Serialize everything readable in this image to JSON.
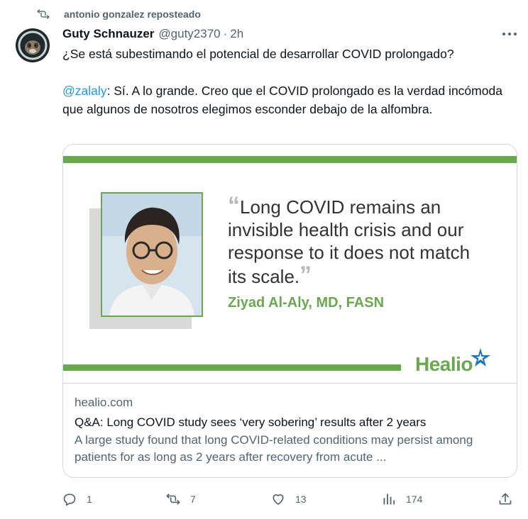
{
  "repost": {
    "text": "antonio gonzalez reposteado",
    "icon": "repost-icon"
  },
  "author": {
    "name": "Guty Schnauzer",
    "handle": "@guty2370",
    "separator": "·",
    "time": "2h",
    "avatar_icon": "avatar-icon"
  },
  "menu": {
    "icon": "more-icon",
    "label": "···"
  },
  "tweet": {
    "line1": "¿Se está subestimando el potencial de desarrollar COVID prolongado?",
    "mention": "@zalaly",
    "reply_text": ": Sí. A lo grande. Creo que el COVID prolongado es la verdad incómoda que algunos de nosotros elegimos esconder debajo de la alfombra."
  },
  "card": {
    "quote_open": "“",
    "quote": "Long COVID remains an invisible health crisis and our response to it does not match its scale.",
    "quote_close": "”",
    "attribution": "Ziyad Al-Aly, MD, FASN",
    "brand": "Healio",
    "accent_color": "#6aa84f",
    "domain": "healio.com",
    "title": "Q&A: Long COVID study sees ‘very sobering’ results after 2 years",
    "description": "A large study found that long COVID-related conditions may persist among patients for as long as 2 years after recovery from acute ..."
  },
  "actions": {
    "reply": {
      "icon": "reply-icon",
      "count": "1"
    },
    "repost": {
      "icon": "repost-icon",
      "count": "7"
    },
    "like": {
      "icon": "heart-icon",
      "count": "13"
    },
    "views": {
      "icon": "views-icon",
      "count": "174"
    },
    "share": {
      "icon": "share-icon"
    }
  },
  "colors": {
    "text": "#0f1419",
    "muted": "#536471",
    "link": "#1d9bf0",
    "border": "#cfd9de",
    "healio_green": "#6aa84f",
    "healio_blue": "#1e73be"
  }
}
